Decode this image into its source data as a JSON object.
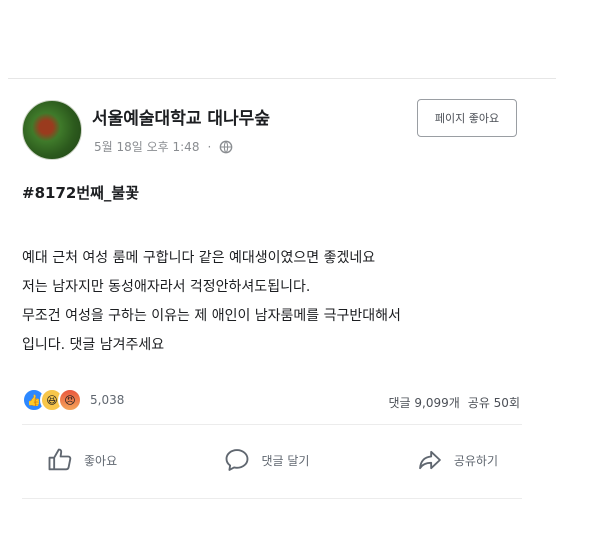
{
  "post": {
    "page_name": "서울예술대학교 대나무숲",
    "timestamp": "5월 18일 오후 1:48",
    "privacy_icon": "globe-icon",
    "like_page_button": "페이지 좋아요",
    "hashtag": "#8172번째_불꽃",
    "body_lines": [
      "예대 근처 여성 룸메 구합니다  같은 예대생이였으면 좋겠네요",
      "저는 남자지만 동성애자라서 걱정안하셔도됩니다.",
      "무조건 여성을 구하는 이유는 제 애인이 남자룸메를 극구반대해서",
      "입니다. 댓글 남겨주세요"
    ],
    "reactions": {
      "icons": [
        "like-reaction-icon",
        "haha-reaction-icon",
        "angry-reaction-icon"
      ],
      "count": "5,038"
    },
    "stats": {
      "comments": "댓글 9,099개",
      "shares": "공유 50회"
    },
    "actions": {
      "like": "좋아요",
      "comment": "댓글 달기",
      "share": "공유하기"
    }
  }
}
